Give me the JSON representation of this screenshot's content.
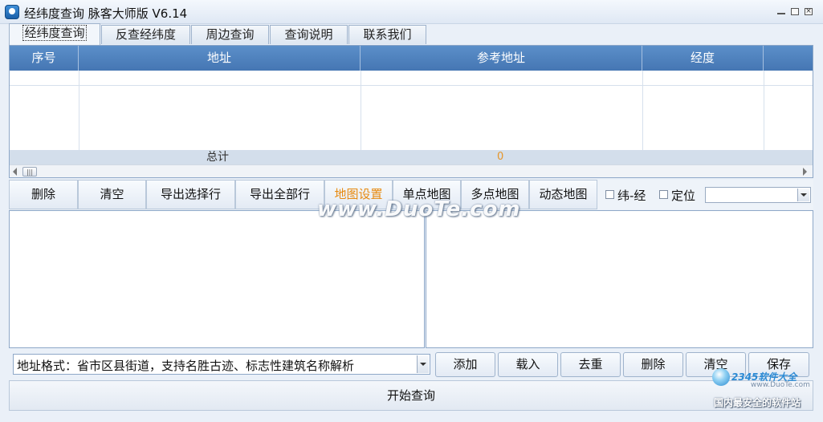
{
  "window": {
    "title": "经纬度查询 脉客大师版 V6.14",
    "minimize_icon": "minimize-icon",
    "maximize_icon": "maximize-icon",
    "close_icon": "close-icon"
  },
  "tabs": [
    {
      "label": "经纬度查询",
      "active": true
    },
    {
      "label": "反查经纬度",
      "active": false
    },
    {
      "label": "周边查询",
      "active": false
    },
    {
      "label": "查询说明",
      "active": false
    },
    {
      "label": "联系我们",
      "active": false
    }
  ],
  "grid": {
    "columns": [
      "序号",
      "地址",
      "参考地址",
      "经度"
    ],
    "total_label": "总计",
    "total_value": "0"
  },
  "toolbar": {
    "delete": "删除",
    "clear": "清空",
    "export_selected": "导出选择行",
    "export_all": "导出全部行",
    "map_settings": "地图设置",
    "single_map": "单点地图",
    "multi_map": "多点地图",
    "dynamic_map": "动态地图",
    "lat_lng_label": "纬-经",
    "locate_label": "定位",
    "combo_value": ""
  },
  "watermark": "www.DuoTe.com",
  "bottom": {
    "address_format": "地址格式：省市区县街道，支持名胜古迹、标志性建筑名称解析",
    "add": "添加",
    "load": "载入",
    "dedupe": "去重",
    "delete": "删除",
    "clear": "清空",
    "save": "保存",
    "start_query": "开始查询"
  },
  "corner_logo": {
    "brand": "2345软件大全",
    "url": "www.DuoTe.com",
    "slogan": "国内最安全的软件站"
  },
  "colors": {
    "header_blue": "#4f83c0",
    "accent_orange": "#e78a10"
  }
}
